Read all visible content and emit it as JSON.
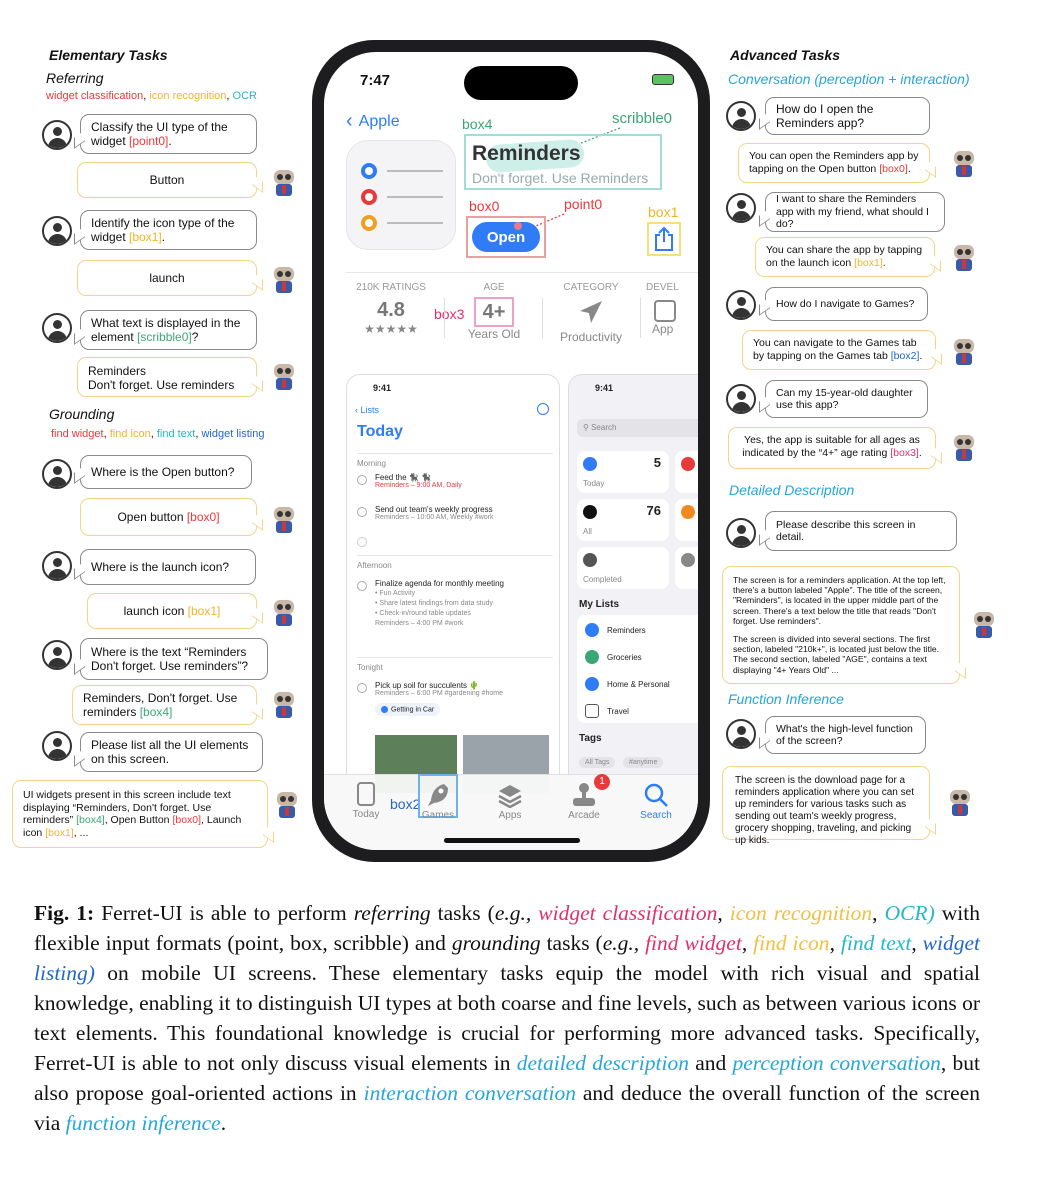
{
  "left": {
    "title": "Elementary Tasks",
    "referring": {
      "title": "Referring",
      "tags": [
        {
          "text": "widget classification",
          "color": "#e83a3a"
        },
        {
          "text": "icon recognition",
          "color": "#f0b429"
        },
        {
          "text": "OCR",
          "color": "#24b6c9"
        }
      ],
      "items": [
        {
          "q": "Classify the UI type of the widget",
          "q_ref": "[point0]",
          "q_tail": ".",
          "a": "Button"
        },
        {
          "q": "Identify the icon type of the widget",
          "q_ref": "[box1]",
          "q_tail": ".",
          "a": "launch"
        },
        {
          "q": "What text is displayed in the element",
          "q_ref": "[scribble0]",
          "q_tail": "?",
          "a1": "Reminders",
          "a2": "Don't forget. Use reminders"
        }
      ]
    },
    "grounding": {
      "title": "Grounding",
      "tags": [
        {
          "text": "find widget",
          "color": "#e83a3a"
        },
        {
          "text": "find icon",
          "color": "#f0b429"
        },
        {
          "text": "find text",
          "color": "#24b6c9"
        },
        {
          "text": "widget listing",
          "color": "#2266c8"
        }
      ],
      "items": [
        {
          "q": "Where is the Open button?",
          "a": "Open button",
          "a_ref": "[box0]"
        },
        {
          "q": "Where is the launch icon?",
          "a": "launch icon",
          "a_ref": "[box1]"
        },
        {
          "q": "Where is the text “Reminders Don't forget. Use reminders”?",
          "a": "Reminders, Don't forget. Use reminders",
          "a_ref": "[box4]"
        },
        {
          "q": "Please list all the UI elements on this screen.",
          "a": "UI widgets present in this screen include text displaying “Reminders, Don't forget. Use reminders”",
          "a_ref1": "[box4]",
          "a_mid": ", Open Button",
          "a_ref2": "[box0]",
          "a_mid2": ", Launch icon",
          "a_ref3": "[box1]",
          "a_end": ", ..."
        }
      ]
    }
  },
  "right": {
    "title": "Advanced Tasks",
    "conversation_title": "Conversation (perception + interaction)",
    "conversation": [
      {
        "q": "How do I open the Reminders app?",
        "a": "You can open the Reminders app by tapping on the Open button",
        "a_ref": "[box0]"
      },
      {
        "q": "I want to share the Reminders app with my friend, what should I do?",
        "a": "You can share the app by tapping on the launch icon",
        "a_ref": "[box1]"
      },
      {
        "q": "How do I navigate to Games?",
        "a": "You can navigate to the Games tab by tapping on the Games tab",
        "a_ref": "[box2]"
      },
      {
        "q": "Can my 15-year-old daughter use this app?",
        "a": "Yes, the app is suitable for all ages as indicated by the “4+” age rating",
        "a_ref": "[box3]"
      }
    ],
    "detailed_title": "Detailed Description",
    "detailed_q": "Please describe this screen in detail.",
    "detailed_a1": "The screen is for a reminders application. At the top left, there's a button labeled \"Apple\". The title of the screen, \"Reminders\", is located in the upper middle part of the screen. There's a text below the title that reads \"Don't forget. Use reminders\".",
    "detailed_a2": "The screen is divided into several sections. The first section, labeled \"210k+\", is located just below the title. The second section, labeled \"AGE\", contains a text displaying \"4+ Years Old\" ...",
    "function_title": "Function Inference",
    "function_q": "What's the high-level function of the screen?",
    "function_a": "The screen is the download page for a reminders application where you can set up reminders for various tasks such as sending out team's weekly progress, grocery shopping, traveling, and picking up kids."
  },
  "phone": {
    "time": "7:47",
    "back_label": "Apple",
    "app_title": "Reminders",
    "app_subtitle": "Don't forget. Use Reminders",
    "open_label": "Open",
    "annot": {
      "box4": "box4",
      "scribble0": "scribble0",
      "box0": "box0",
      "point0": "point0",
      "box1": "box1",
      "box3": "box3",
      "box2": "box2"
    },
    "stats": [
      {
        "label": "210K RATINGS",
        "value": "4.8",
        "sub": "★★★★★"
      },
      {
        "label": "AGE",
        "value": "4+",
        "sub": "Years Old"
      },
      {
        "label": "CATEGORY",
        "value": "",
        "sub": "Productivity"
      },
      {
        "label": "DEVEL",
        "value": "",
        "sub": "App"
      }
    ],
    "shot1": {
      "time": "9:41",
      "back": "Lists",
      "title": "Today",
      "morning": "Morning",
      "items_morning": [
        {
          "title": "Feed the 🐈‍⬛ 🐈‍⬛",
          "meta": "Reminders – 9:00 AM, Daily"
        },
        {
          "title": "Send out team's weekly progress",
          "meta": "Reminders – 10:00 AM, Weekly #work"
        }
      ],
      "afternoon": "Afternoon",
      "item_afternoon": {
        "title": "Finalize agenda for monthly meeting",
        "b1": "• Fun Activity",
        "b2": "• Share latest findings from data study",
        "b3": "• Check-in/round table updates",
        "meta": "Reminders – 4:00 PM #work"
      },
      "tonight": "Tonight",
      "item_tonight": {
        "title": "Pick up soil for succulents 🌵",
        "meta": "Reminders – 6:00 PM #gardening #home",
        "chip": "Getting in Car"
      }
    },
    "shot2": {
      "time": "9:41",
      "search": "Search",
      "cards": [
        {
          "label": "Today",
          "count": "5",
          "color": "#2f7cf6"
        },
        {
          "label": "All",
          "count": "76",
          "color": "#111"
        },
        {
          "label": "Completed",
          "count": "",
          "color": "#555"
        }
      ],
      "my_lists": "My Lists",
      "lists": [
        {
          "name": "Reminders",
          "color": "#2f7cf6"
        },
        {
          "name": "Groceries",
          "color": "#3aa675"
        },
        {
          "name": "Home & Personal",
          "color": "#2f7cf6"
        },
        {
          "name": "Travel",
          "color": "#555"
        }
      ],
      "tags": "Tags",
      "tag_chips": [
        "All Tags",
        "#anytime"
      ]
    },
    "tabs": [
      {
        "label": "Today",
        "icon": "today-icon"
      },
      {
        "label": "Games",
        "icon": "rocket-icon"
      },
      {
        "label": "Apps",
        "icon": "stack-icon"
      },
      {
        "label": "Arcade",
        "icon": "joystick-icon",
        "badge": "1"
      },
      {
        "label": "Search",
        "icon": "search-icon"
      }
    ]
  },
  "caption": {
    "fig": "Fig. 1:",
    "p1": " Ferret-UI is able to perform ",
    "referring": "referring",
    "p2": " tasks (",
    "eg1": "e.g.,",
    "t1": "widget classification",
    "t2": "icon recognition",
    "t3": "OCR)",
    "p3": " with flexible input formats (point, box, scribble) and ",
    "grounding": "grounding",
    "p4": " tasks (",
    "eg2": "e.g.,",
    "g1": "find widget",
    "g2": "find icon",
    "g3": "find text",
    "g4": "widget listing)",
    "p5": " on mobile UI screens. These elementary tasks equip the model with rich visual and spatial knowledge, enabling it to distinguish UI types at both coarse and fine levels, such as between various icons or text elements. This foundational knowledge is crucial for performing more advanced tasks. Specifically, Ferret-UI is able to not only discuss visual elements in ",
    "d1": "detailed description",
    "p6": " and ",
    "d2": "perception conversation",
    "p7": ", but also propose goal-oriented actions in ",
    "d3": "interaction conversation",
    "p8": " and deduce the overall function of the screen via ",
    "d4": "function inference",
    "p9": "."
  }
}
